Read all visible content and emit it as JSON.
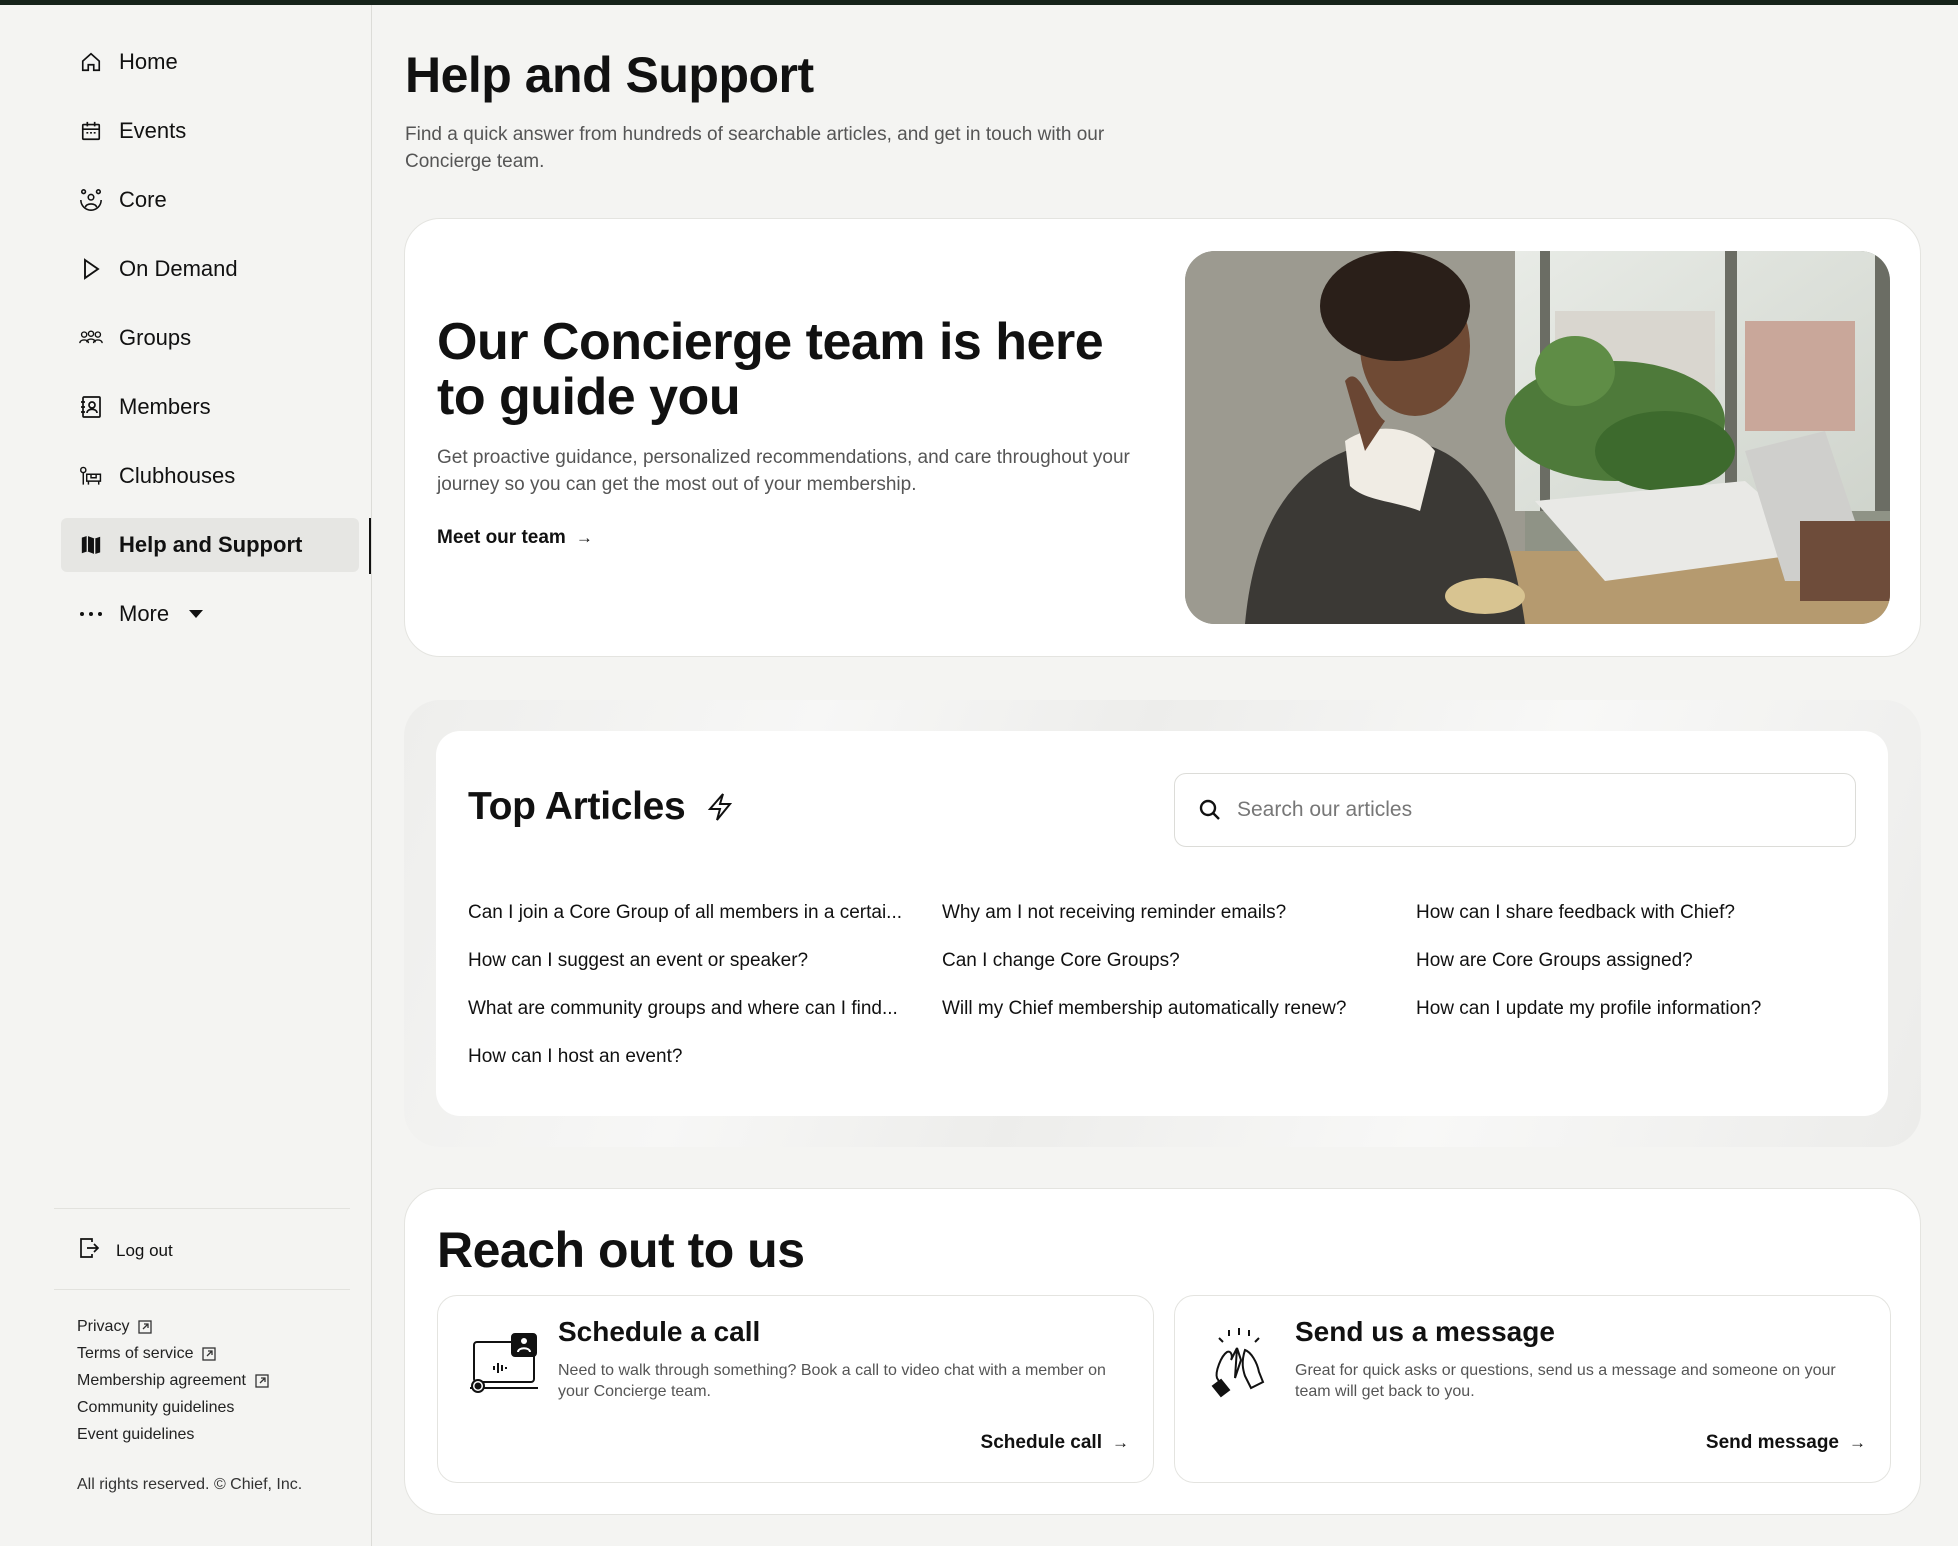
{
  "sidebar": {
    "nav": [
      {
        "label": "Home",
        "icon": "home-icon"
      },
      {
        "label": "Events",
        "icon": "calendar-icon"
      },
      {
        "label": "Core",
        "icon": "core-icon"
      },
      {
        "label": "On Demand",
        "icon": "play-icon"
      },
      {
        "label": "Groups",
        "icon": "groups-icon"
      },
      {
        "label": "Members",
        "icon": "members-icon"
      },
      {
        "label": "Clubhouses",
        "icon": "clubhouse-icon"
      },
      {
        "label": "Help and Support",
        "icon": "map-icon",
        "active": true
      },
      {
        "label": "More",
        "icon": "more-icon"
      }
    ],
    "logout_label": "Log out",
    "footer_links": [
      "Privacy",
      "Terms of service",
      "Membership agreement",
      "Community guidelines",
      "Event guidelines"
    ],
    "copyright": "All rights reserved. © Chief, Inc."
  },
  "main": {
    "title": "Help and Support",
    "subtitle": "Find a quick answer from hundreds of searchable articles, and get in touch with our Concierge team.",
    "hero": {
      "title": "Our Concierge team is here to guide you",
      "text": "Get proactive guidance, personalized recommendations, and care throughout your journey so you can get the most out of your membership.",
      "link": "Meet our team"
    },
    "articles": {
      "title": "Top Articles",
      "search_placeholder": "Search our articles",
      "columns": [
        [
          "Can I join a Core Group of all members in a certai...",
          "How can I suggest an event or speaker?",
          "What are community groups and where can I find...",
          "How can I host an event?"
        ],
        [
          "Why am I not receiving reminder emails?",
          "Can I change Core Groups?",
          "Will my Chief membership automatically renew?"
        ],
        [
          "How can I share feedback with Chief?",
          "How are Core Groups assigned?",
          "How can I update my profile information?"
        ]
      ]
    },
    "reach": {
      "title": "Reach out to us",
      "call": {
        "title": "Schedule a call",
        "text": "Need to walk through something? Book a call to video chat with a member on your Concierge team.",
        "action": "Schedule call"
      },
      "message": {
        "title": "Send us a message",
        "text": "Great for quick asks or questions, send us a message and someone on your team will get back to you.",
        "action": "Send message"
      }
    }
  },
  "colors": {
    "accent_dark": "#16231a",
    "active_bg": "#e6e6e3"
  }
}
